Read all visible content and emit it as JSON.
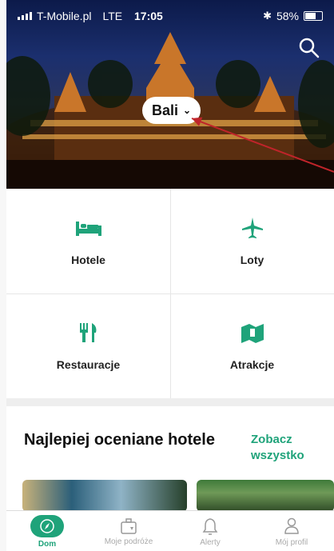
{
  "status": {
    "carrier": "T-Mobile.pl",
    "network": "LTE",
    "time": "17:05",
    "battery": "58%"
  },
  "hero": {
    "location": "Bali"
  },
  "categories": [
    {
      "label": "Hotele",
      "icon": "bed-icon"
    },
    {
      "label": "Loty",
      "icon": "plane-icon"
    },
    {
      "label": "Restauracje",
      "icon": "restaurant-icon"
    },
    {
      "label": "Atrakcje",
      "icon": "ticket-icon"
    }
  ],
  "rated": {
    "title": "Najlepiej oceniane hotele",
    "see_all": "Zobacz wszystko"
  },
  "nav": [
    {
      "label": "Dom",
      "icon": "compass-icon",
      "active": true
    },
    {
      "label": "Moje podróże",
      "icon": "suitcase-icon"
    },
    {
      "label": "Alerty",
      "icon": "bell-icon"
    },
    {
      "label": "Mój profil",
      "icon": "user-icon"
    }
  ],
  "colors": {
    "accent": "#1fa37a"
  }
}
